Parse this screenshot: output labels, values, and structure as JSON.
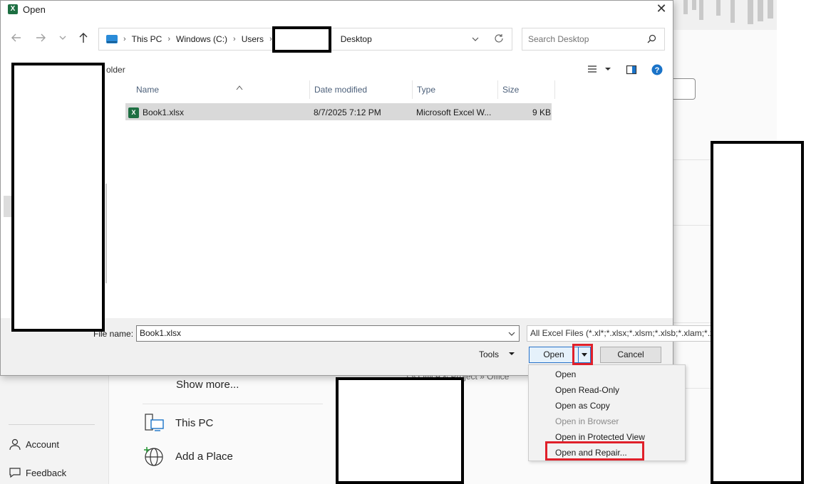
{
  "window": {
    "title": "Open",
    "app_icon": "X",
    "close_symbol": "✕"
  },
  "address_bar": {
    "crumbs": [
      "This PC",
      "Windows (C:)",
      "Users",
      "",
      "Desktop"
    ]
  },
  "search": {
    "placeholder": "Search Desktop"
  },
  "toolbar": {
    "new_folder_label": "older"
  },
  "columns": {
    "name": "Name",
    "date": "Date modified",
    "type": "Type",
    "size": "Size"
  },
  "files": [
    {
      "name": "Book1.xlsx",
      "date": "8/7/2025 7:12 PM",
      "type": "Microsoft Excel W...",
      "size": "9 KB"
    }
  ],
  "bottom": {
    "file_name_label": "File name:",
    "file_name_value": "Book1.xlsx",
    "filter": "All Excel Files (*.xl*;*.xlsx;*.xlsm;*.xlsb;*.xlam;*.xltx",
    "tools_label": "Tools",
    "open_label": "Open",
    "cancel_label": "Cancel"
  },
  "open_menu": [
    {
      "label": "Open",
      "enabled": true
    },
    {
      "label": "Open Read-Only",
      "enabled": true
    },
    {
      "label": "Open as Copy",
      "enabled": true
    },
    {
      "label": "Open in Browser",
      "enabled": false
    },
    {
      "label": "Open in Protected View",
      "enabled": true
    },
    {
      "label": "Open and Repair...",
      "enabled": true
    }
  ],
  "backstage": {
    "show_more": "Show more...",
    "this_pc": "This PC",
    "add_place": "Add a Place",
    "account": "Account",
    "feedback": "Feedback",
    "path_fragment": "...\\ » Office & Project » Office"
  },
  "colors": {
    "highlight": "#e0202a",
    "excel_green": "#1d6f42",
    "selected_row": "#d9d9d9",
    "accent_blue": "#2672c9"
  }
}
